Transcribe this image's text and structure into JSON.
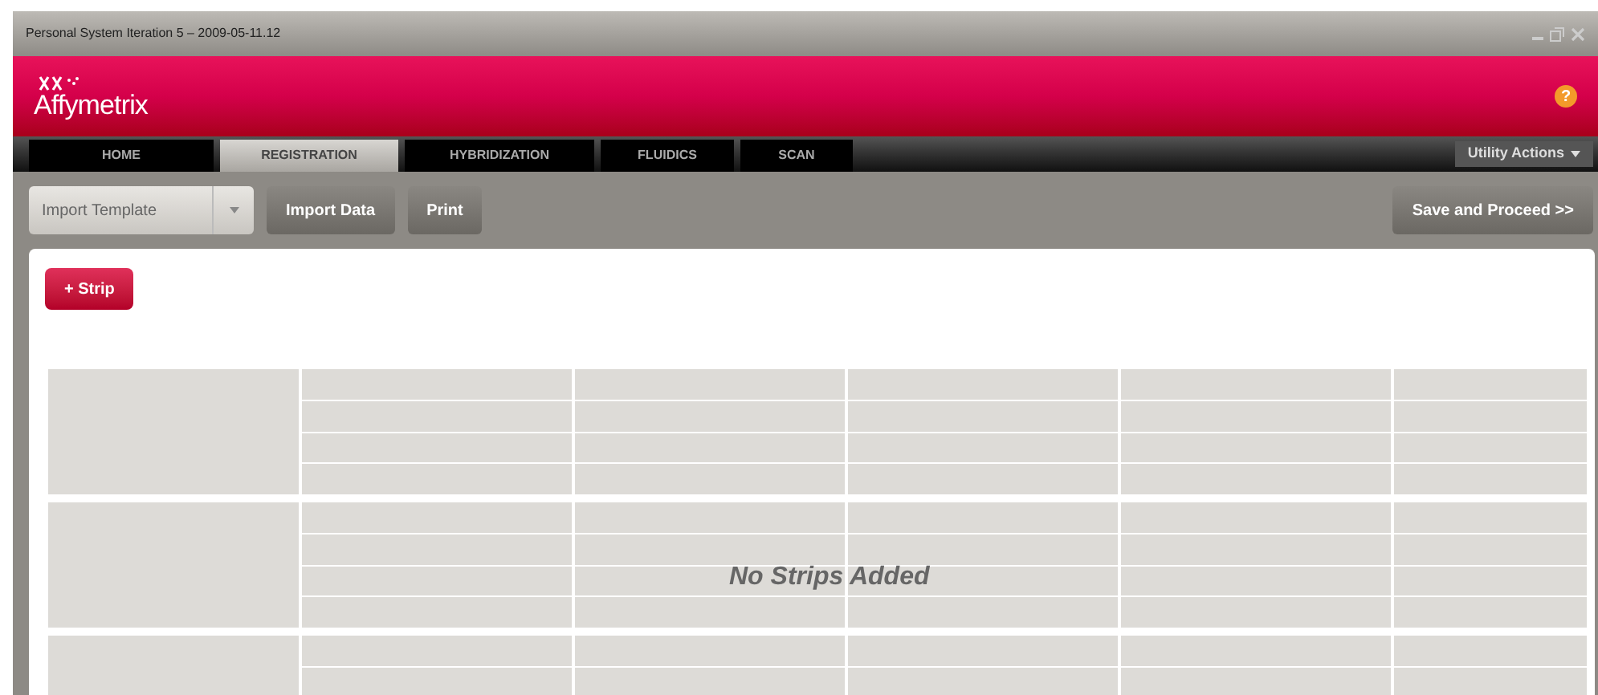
{
  "window": {
    "title": "Personal System Iteration 5 – 2009-05-11.12"
  },
  "header": {
    "logo": "Affymetrix",
    "help": "?"
  },
  "tabs": [
    {
      "label": "HOME",
      "selected": false
    },
    {
      "label": "REGISTRATION",
      "selected": true
    },
    {
      "label": "HYBRIDIZATION",
      "selected": false
    },
    {
      "label": "FLUIDICS",
      "selected": false
    },
    {
      "label": "SCAN",
      "selected": false
    }
  ],
  "utility_menu": {
    "label": "Utility Actions"
  },
  "toolbar": {
    "template_dropdown": {
      "value": "Import Template"
    },
    "buttons": [
      "Import Data",
      "Print"
    ],
    "proceed": "Save and Proceed >>"
  },
  "content": {
    "add_button": "+ Strip",
    "empty_message": "No Strips Added"
  }
}
